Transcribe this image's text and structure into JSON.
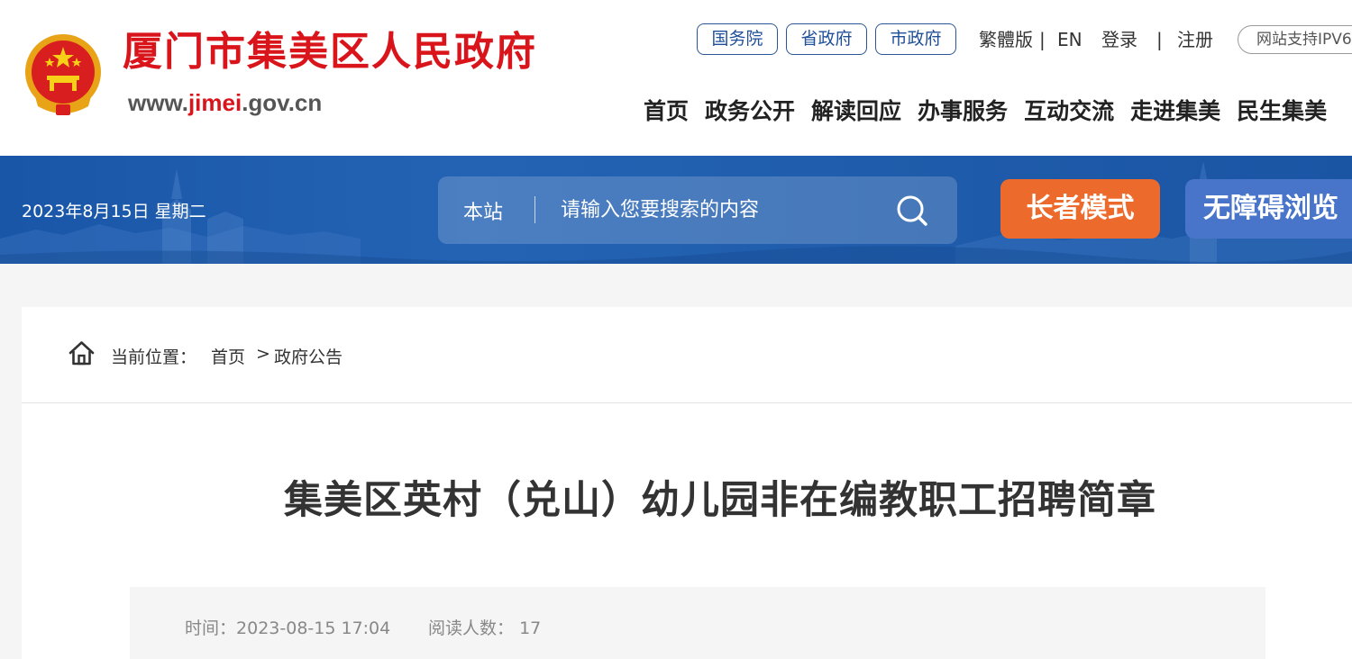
{
  "header": {
    "site_title": "厦门市集美区人民政府",
    "site_domain_prefix": "www.",
    "site_domain_accent": "jimei",
    "site_domain_suffix": ".gov.cn",
    "top_links": {
      "state_council": "国务院",
      "province": "省政府",
      "city": "市政府",
      "traditional": "繁體版",
      "english": "EN",
      "login": "登录",
      "register": "注册",
      "ipv6": "网站支持IPV6"
    },
    "separators": [
      "|",
      "|"
    ],
    "nav": [
      "首页",
      "政务公开",
      "解读回应",
      "办事服务",
      "互动交流",
      "走进集美",
      "民生集美"
    ]
  },
  "banner": {
    "date": "2023年8月15日 星期二",
    "search_scope": "本站",
    "search_placeholder": "请输入您要搜索的内容",
    "elder_mode": "长者模式",
    "accessibility": "无障碍浏览"
  },
  "breadcrumb": {
    "label": "当前位置：",
    "items": [
      "首页",
      "政府公告"
    ],
    "separator": ">"
  },
  "article": {
    "title": "集美区英村（兑山）幼儿园非在编教职工招聘简章",
    "time_label": "时间：",
    "time_value": "2023-08-15 17:04",
    "views_label": "阅读人数：",
    "views_value": "17"
  },
  "colors": {
    "brand_red": "#d9151b",
    "banner_blue": "#1f5cab",
    "elder_orange": "#ec6a2b",
    "access_blue": "#4874c9"
  },
  "icons": [
    "national-emblem-icon",
    "search-icon",
    "home-icon"
  ]
}
